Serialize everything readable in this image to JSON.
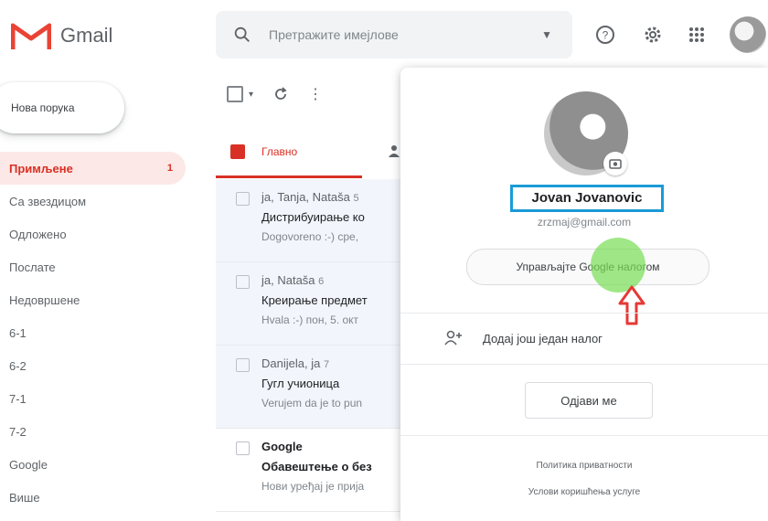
{
  "app": {
    "name": "Gmail",
    "brand_red": "#d93025",
    "accent_blue": "#1a9bd7"
  },
  "search": {
    "placeholder": "Претражите имејлове"
  },
  "icons": {
    "help": "help-icon",
    "settings": "gear-icon",
    "apps": "apps-grid-icon",
    "search": "search-icon"
  },
  "compose": {
    "label": "Нова порука"
  },
  "nav": [
    {
      "label": "Примљене",
      "count": "1",
      "active": true
    },
    {
      "label": "Са звездицом"
    },
    {
      "label": "Одложено"
    },
    {
      "label": "Послате"
    },
    {
      "label": "Недовршене"
    },
    {
      "label": "6-1"
    },
    {
      "label": "6-2"
    },
    {
      "label": "7-1"
    },
    {
      "label": "7-2"
    },
    {
      "label": "Google"
    },
    {
      "label": "Више"
    }
  ],
  "tabs": {
    "main": "Главно"
  },
  "mails": [
    {
      "from": "ја, Tanja, Nataša",
      "count": "5",
      "subject": "Дистрибуирање ко",
      "snippet": "Dogovoreno :-) сре, ",
      "unread": false
    },
    {
      "from": "ја, Nataša",
      "count": "6",
      "subject": "Креирање предмет",
      "snippet": "Hvala :-) пон, 5. окт",
      "unread": false
    },
    {
      "from": "Danijela, ја",
      "count": "7",
      "subject": "Гугл учионица",
      "snippet": "Verujem da je to pun",
      "unread": false
    },
    {
      "from": "Google",
      "count": "",
      "subject": "Обавештење о без",
      "snippet": "Нови уређај је прија",
      "unread": true
    }
  ],
  "account_popup": {
    "name": "Jovan Jovanovic",
    "email": "zrzmaj@gmail.com",
    "manage_label": "Управљајте Google налогом",
    "add_account_label": "Додај још један налог",
    "sign_out_label": "Одјави ме",
    "privacy_label": "Политика приватности",
    "terms_label": "Услови коришћења услуге"
  }
}
